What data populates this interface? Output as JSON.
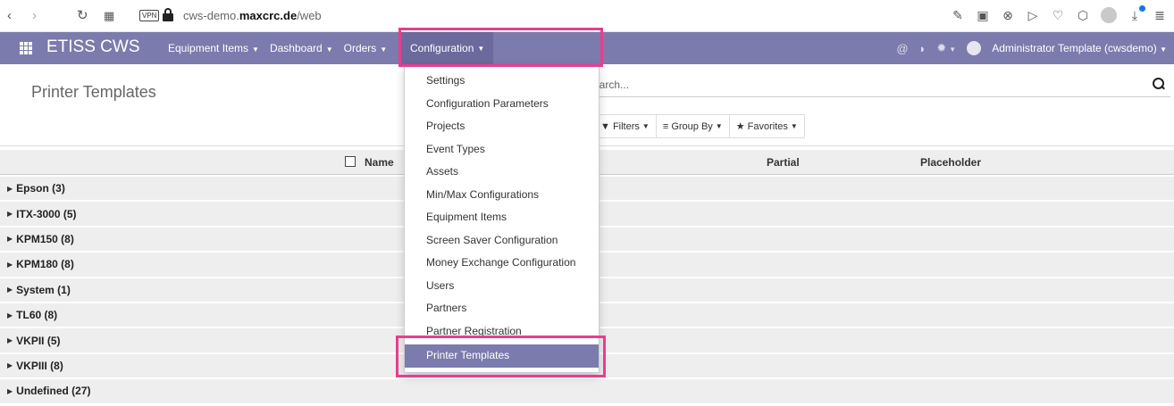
{
  "browser": {
    "url_prefix": "cws-demo.",
    "url_host": "maxcrc.de",
    "url_path": "/web",
    "vpn_label": "VPN"
  },
  "navbar": {
    "brand": "ETISS CWS",
    "menus": [
      {
        "label": "Equipment Items"
      },
      {
        "label": "Dashboard"
      },
      {
        "label": "Orders"
      }
    ],
    "active_menu": "Configuration",
    "user": "Administrator Template (cwsdemo)",
    "color": "#7c7bad"
  },
  "control_panel": {
    "title": "Printer Templates",
    "search_placeholder": "Search...",
    "filters": [
      {
        "label": "Filters",
        "icon": "funnel-icon"
      },
      {
        "label": "Group By",
        "icon": "list-icon"
      },
      {
        "label": "Favorites",
        "icon": "star-icon"
      }
    ]
  },
  "table": {
    "columns": [
      "Name",
      "Partial",
      "Placeholder"
    ],
    "groups": [
      {
        "label": "Epson (3)"
      },
      {
        "label": "ITX-3000 (5)"
      },
      {
        "label": "KPM150 (8)"
      },
      {
        "label": "KPM180 (8)"
      },
      {
        "label": "System (1)"
      },
      {
        "label": "TL60 (8)"
      },
      {
        "label": "VKPII (5)"
      },
      {
        "label": "VKPIII (8)"
      },
      {
        "label": "Undefined (27)"
      }
    ]
  },
  "dropdown": {
    "items": [
      {
        "label": "Settings"
      },
      {
        "label": "Configuration Parameters"
      },
      {
        "label": "Projects"
      },
      {
        "label": "Event Types"
      },
      {
        "label": "Assets"
      },
      {
        "label": "Min/Max Configurations"
      },
      {
        "label": "Equipment Items"
      },
      {
        "label": "Screen Saver Configuration"
      },
      {
        "label": "Money Exchange Configuration"
      },
      {
        "label": "Users"
      },
      {
        "label": "Partners"
      },
      {
        "label": "Partner Registration"
      },
      {
        "label": "Printer Templates",
        "active": true
      }
    ]
  },
  "highlight_color": "#e83e8c"
}
